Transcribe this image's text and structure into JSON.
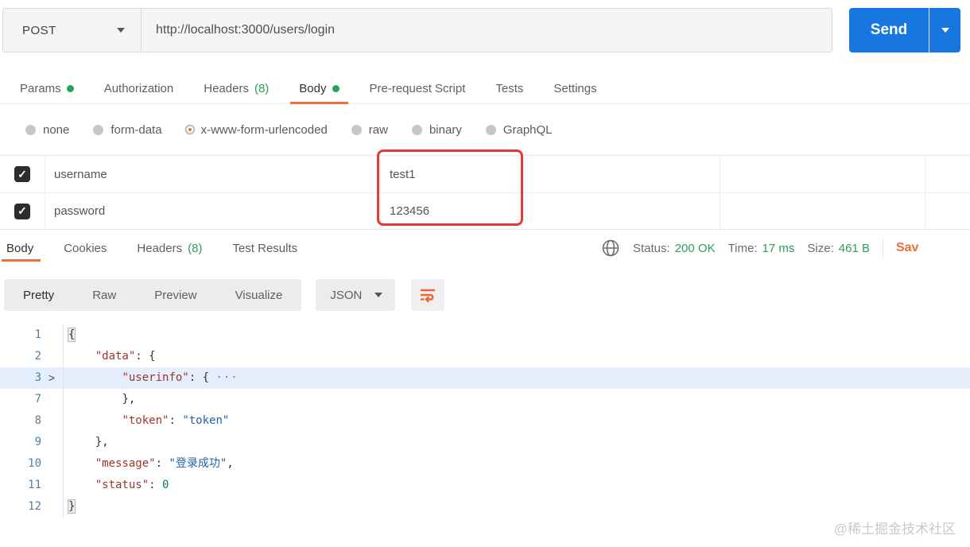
{
  "request_bar": {
    "method": "POST",
    "url": "http://localhost:3000/users/login",
    "send_label": "Send"
  },
  "request_tabs": [
    {
      "label": "Params",
      "dot": true
    },
    {
      "label": "Authorization"
    },
    {
      "label": "Headers",
      "count": "(8)"
    },
    {
      "label": "Body",
      "dot": true,
      "active": true
    },
    {
      "label": "Pre-request Script"
    },
    {
      "label": "Tests"
    },
    {
      "label": "Settings"
    }
  ],
  "body_type_options": [
    {
      "label": "none"
    },
    {
      "label": "form-data"
    },
    {
      "label": "x-www-form-urlencoded",
      "selected": true
    },
    {
      "label": "raw"
    },
    {
      "label": "binary"
    },
    {
      "label": "GraphQL"
    }
  ],
  "params_table": {
    "rows": [
      {
        "checked": true,
        "key": "username",
        "value": "test1",
        "description": ""
      },
      {
        "checked": true,
        "key": "password",
        "value": "123456",
        "description": ""
      }
    ]
  },
  "response_meta": {
    "tabs": [
      {
        "label": "Body",
        "active": true
      },
      {
        "label": "Cookies"
      },
      {
        "label": "Headers",
        "count": "(8)"
      },
      {
        "label": "Test Results"
      }
    ],
    "status_label": "Status:",
    "status_value": "200 OK",
    "time_label": "Time:",
    "time_value": "17 ms",
    "size_label": "Size:",
    "size_value": "461 B",
    "save_label": "Sav"
  },
  "response_view": {
    "modes": [
      {
        "label": "Pretty",
        "active": true
      },
      {
        "label": "Raw"
      },
      {
        "label": "Preview"
      },
      {
        "label": "Visualize"
      }
    ],
    "format": "JSON"
  },
  "response_code": {
    "lines": [
      {
        "num": "1",
        "tokens": [
          {
            "t": "{",
            "c": "brace",
            "m": true
          }
        ]
      },
      {
        "num": "2",
        "tokens": [
          {
            "t": "    ",
            "c": "ws"
          },
          {
            "t": "\"data\"",
            "c": "key"
          },
          {
            "t": ": {",
            "c": "punct"
          }
        ]
      },
      {
        "num": "3",
        "fold": true,
        "highlight": true,
        "tokens": [
          {
            "t": "        ",
            "c": "ws"
          },
          {
            "t": "\"userinfo\"",
            "c": "key"
          },
          {
            "t": ": { ",
            "c": "punct"
          },
          {
            "t": "···",
            "c": "ellipsis"
          }
        ]
      },
      {
        "num": "7",
        "tokens": [
          {
            "t": "        ",
            "c": "ws"
          },
          {
            "t": "},",
            "c": "punct"
          }
        ]
      },
      {
        "num": "8",
        "tokens": [
          {
            "t": "        ",
            "c": "ws"
          },
          {
            "t": "\"token\"",
            "c": "key"
          },
          {
            "t": ": ",
            "c": "punct"
          },
          {
            "t": "\"token\"",
            "c": "string"
          }
        ]
      },
      {
        "num": "9",
        "tokens": [
          {
            "t": "    ",
            "c": "ws"
          },
          {
            "t": "},",
            "c": "punct"
          }
        ]
      },
      {
        "num": "10",
        "tokens": [
          {
            "t": "    ",
            "c": "ws"
          },
          {
            "t": "\"message\"",
            "c": "key"
          },
          {
            "t": ": ",
            "c": "punct"
          },
          {
            "t": "\"登录成功\"",
            "c": "string"
          },
          {
            "t": ",",
            "c": "punct"
          }
        ]
      },
      {
        "num": "11",
        "tokens": [
          {
            "t": "    ",
            "c": "ws"
          },
          {
            "t": "\"status\"",
            "c": "key"
          },
          {
            "t": ": ",
            "c": "punct"
          },
          {
            "t": "0",
            "c": "number"
          }
        ]
      },
      {
        "num": "12",
        "tokens": [
          {
            "t": "}",
            "c": "brace",
            "m": true
          }
        ]
      }
    ]
  },
  "icons": {
    "method_caret": "chevron-down-icon",
    "send_caret": "chevron-down-icon",
    "globe": "globe-icon",
    "wrap": "wrap-lines-icon",
    "fold": "fold-arrow-icon",
    "check": "✓",
    "fold_glyph": ">"
  },
  "colors": {
    "orange": "#f26b3b",
    "blue": "#1776e0",
    "green": "#2aa05c",
    "red": "#e23b3b",
    "key": "#a0342d",
    "str": "#2563a8",
    "num": "#127a63",
    "ln": "#4d7fa6",
    "hl": "#e4eefc"
  },
  "watermark": "@稀土掘金技术社区"
}
